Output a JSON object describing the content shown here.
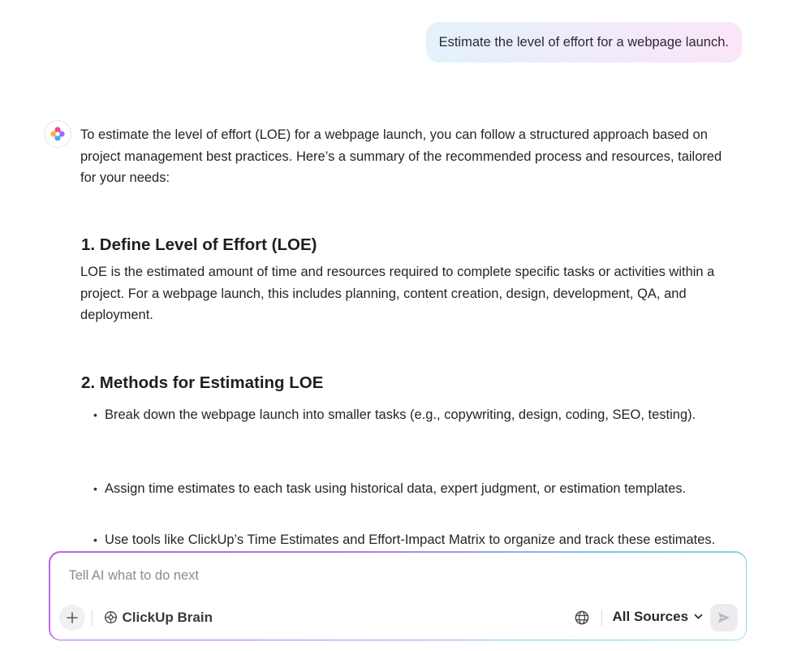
{
  "user_message": "Estimate the level of effort for a webpage launch.",
  "ai_response": {
    "intro": "To estimate the level of effort (LOE) for a webpage launch, you can follow a structured approach based on project management best practices. Here’s a summary of the recommended process and resources, tailored for your needs:",
    "section1": {
      "heading": "1. Define Level of Effort (LOE)",
      "text": "LOE is the estimated amount of time and resources required to complete specific tasks or activities within a project. For a webpage launch, this includes planning, content creation, design, development, QA, and deployment."
    },
    "section2": {
      "heading": "2. Methods for Estimating LOE",
      "bullets": [
        "Break down the webpage launch into smaller tasks (e.g., copywriting, design, coding, SEO, testing).",
        "Assign time estimates to each task using historical data, expert judgment, or estimation templates.",
        "Use tools like ClickUp’s Time Estimates and Effort-Impact Matrix to organize and track these estimates."
      ]
    }
  },
  "composer": {
    "placeholder": "Tell AI what to do next",
    "brain_label": "ClickUp Brain",
    "sources_label": "All Sources",
    "icons": {
      "add": "plus-icon",
      "brain": "brain-icon",
      "web": "globe-icon",
      "dropdown": "chevron-down-icon",
      "send": "send-icon"
    }
  },
  "colors": {
    "bubble_gradient_start": "#e3f2fd",
    "bubble_gradient_end": "#fbe6f8",
    "composer_border_start": "#b667e8",
    "composer_border_end": "#93d9f0"
  }
}
